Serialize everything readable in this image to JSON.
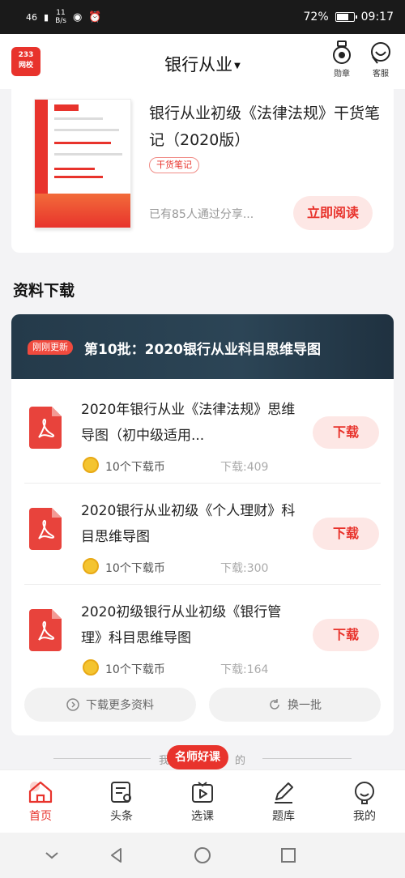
{
  "status_bar": {
    "signal": "46",
    "speed_value": "11",
    "speed_unit": "B/s",
    "battery": "72%",
    "battery_fraction": 0.72,
    "time": "09:17"
  },
  "header": {
    "logo_line1": "233",
    "logo_line2": "网校",
    "title": "银行从业",
    "medal_label": "勋章",
    "service_label": "客服"
  },
  "book": {
    "cover_brand": "233网校",
    "title": "银行从业初级《法律法规》干货笔记（2020版）",
    "tag": "干货笔记",
    "subtitle": "已有85人通过分享...",
    "read_label": "立即阅读"
  },
  "downloads": {
    "section_title": "资料下载",
    "banner_badge": "刚刚更新",
    "banner_title": "第10批：2020银行从业科目思维导图",
    "items": [
      {
        "name": "2020年银行从业《法律法规》思维导图（初中级适用...",
        "coins": "10个下载币",
        "count": "下载:409",
        "button": "下载"
      },
      {
        "name": "2020银行从业初级《个人理财》科目思维导图",
        "coins": "10个下载币",
        "count": "下载:300",
        "button": "下载"
      },
      {
        "name": "2020初级银行从业初级《银行管理》科目思维导图",
        "coins": "10个下载币",
        "count": "下载:164",
        "button": "下载"
      }
    ],
    "more_label": "下载更多资料",
    "refresh_label": "换一批"
  },
  "divider": {
    "text_left": "我",
    "text_right": "的",
    "popular_label": "名师好课"
  },
  "tabbar": {
    "tabs": [
      {
        "label": "首页"
      },
      {
        "label": "头条"
      },
      {
        "label": "选课"
      },
      {
        "label": "题库"
      },
      {
        "label": "我的"
      }
    ]
  },
  "colors": {
    "accent": "#e8332c",
    "accent_light": "#fde7e5",
    "banner": "#243a4a"
  }
}
